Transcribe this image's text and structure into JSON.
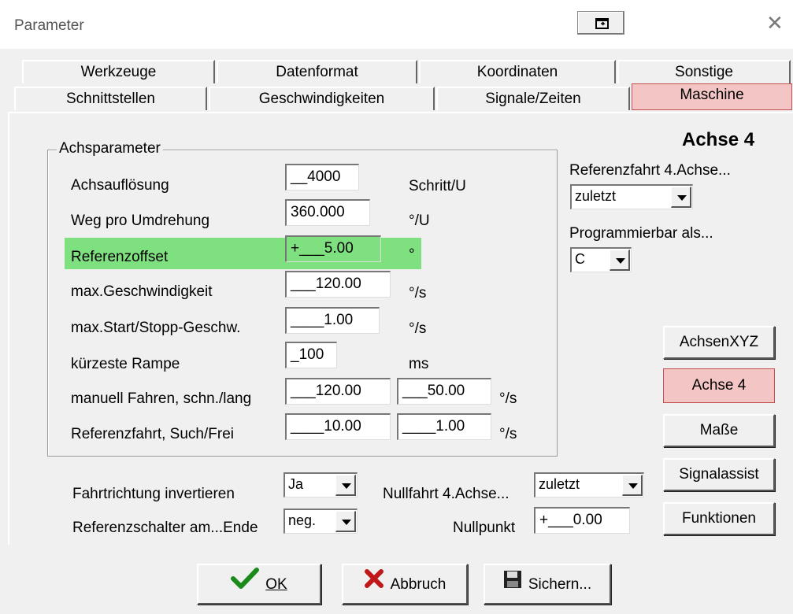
{
  "window": {
    "title": "Parameter"
  },
  "tabs": {
    "row1": [
      "Werkzeuge",
      "Datenformat",
      "Koordinaten",
      "Sonstige"
    ],
    "row2": [
      "Schnittstellen",
      "Geschwindigkeiten",
      "Signale/Zeiten",
      "Maschine"
    ],
    "active": "Maschine"
  },
  "heading": "Achse 4",
  "group": {
    "title": "Achsparameter",
    "rows": [
      {
        "label": "Achsauflösung",
        "value": "__4000",
        "unit": "Schritt/U"
      },
      {
        "label": "Weg pro Umdrehung",
        "value": "360.000",
        "unit": "°/U"
      },
      {
        "label": "Referenzoffset",
        "value": "+___5.00",
        "unit": "°"
      },
      {
        "label": "max.Geschwindigkeit",
        "value": "___120.00",
        "unit": "°/s"
      },
      {
        "label": "max.Start/Stopp-Geschw.",
        "value": "____1.00",
        "unit": "°/s"
      },
      {
        "label": "kürzeste Rampe",
        "value": "_100",
        "unit": "ms"
      },
      {
        "label": "manuell Fahren, schn./lang",
        "value": "___120.00",
        "value2": "___50.00",
        "unit": "°/s"
      },
      {
        "label": "Referenzfahrt, Such/Frei",
        "value": "____10.00",
        "value2": "____1.00",
        "unit": "°/s"
      }
    ]
  },
  "right": {
    "ref_label": "Referenzfahrt 4.Achse...",
    "ref_value": "zuletzt",
    "prog_label": "Programmierbar als...",
    "prog_value": "C"
  },
  "bottom": {
    "fahrtrichtung_label": "Fahrtrichtung invertieren",
    "fahrtrichtung_value": "Ja",
    "refschalter_label": "Referenzschalter am...Ende",
    "refschalter_value": "neg.",
    "nullfahrt_label": "Nullfahrt 4.Achse...",
    "nullfahrt_value": "zuletzt",
    "nullpunkt_label": "Nullpunkt",
    "nullpunkt_value": "+___0.00"
  },
  "side_buttons": [
    "AchsenXYZ",
    "Achse 4",
    "Maße",
    "Signalassist",
    "Funktionen"
  ],
  "footer": {
    "ok": "OK",
    "abbruch": "Abbruch",
    "sichern": "Sichern..."
  },
  "colors": {
    "active_tab": "#f4c5c5",
    "highlight": "#7fe07f"
  }
}
